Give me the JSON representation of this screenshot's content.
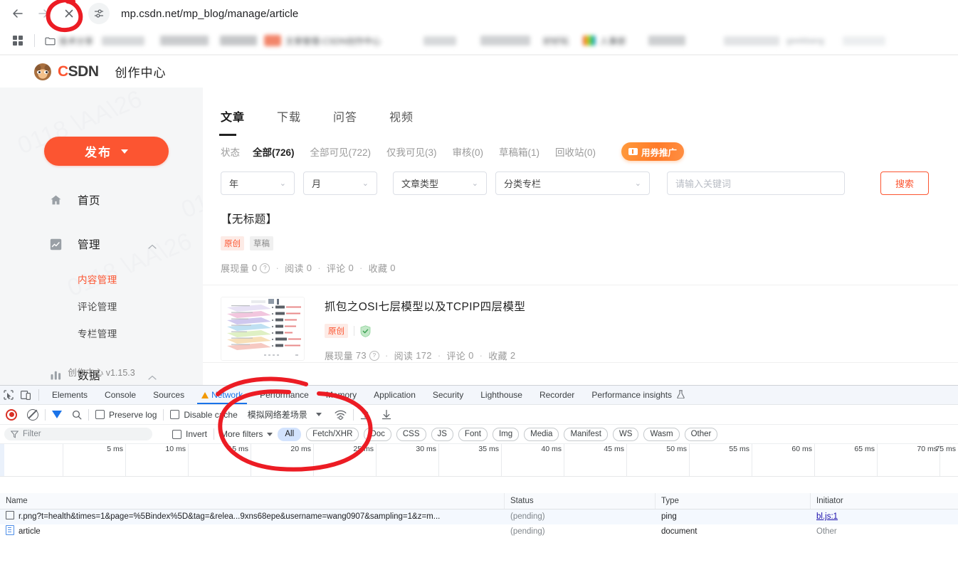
{
  "browser": {
    "url": "mp.csdn.net/mp_blog/manage/article",
    "back_icon": "back-arrow-icon",
    "forward_icon": "forward-arrow-icon",
    "stop_icon": "stop-loading-icon",
    "site_info_icon": "site-settings-icon",
    "apps_icon": "apps-grid-icon",
    "bookmarks": [
      {
        "label": "技术分享",
        "icon": "folder-icon",
        "blurred": true
      },
      {
        "label": "",
        "icon": "",
        "blurred": true
      },
      {
        "label": "",
        "icon": "",
        "blurred": true
      },
      {
        "label": "文章管理-CSDN创作中心",
        "icon": "csdn-icon",
        "blurred": true
      },
      {
        "label": "",
        "icon": "",
        "blurred": true
      },
      {
        "label": "好好玩",
        "icon": "",
        "blurred": true
      },
      {
        "label": "人事部",
        "icon": "rainbow-icon",
        "blurred": true
      },
      {
        "label": "",
        "icon": "",
        "blurred": true
      },
      {
        "label": "geekbang",
        "icon": "",
        "blurred": true
      }
    ]
  },
  "csdn": {
    "brand": "CSDN",
    "brand_prefix": "C",
    "brand_rest": "SDN",
    "subtitle": "创作中心",
    "logo_icon": "csdn-monkey-logo",
    "version": "创作中心 v1.15.3",
    "publish_button": "发布",
    "publish_caret_icon": "chevron-down-icon",
    "sidebar": [
      {
        "label": "首页",
        "icon": "home-icon",
        "expandable": false
      },
      {
        "label": "管理",
        "icon": "chart-line-icon",
        "expandable": true,
        "chevron": "chevron-up-icon",
        "children": [
          {
            "label": "内容管理",
            "active": true
          },
          {
            "label": "评论管理",
            "active": false
          },
          {
            "label": "专栏管理",
            "active": false
          }
        ]
      },
      {
        "label": "数据",
        "icon": "bar-chart-icon",
        "expandable": true,
        "chevron": "chevron-up-icon",
        "children": []
      }
    ],
    "watermark_text": "0118 \\AA\\26",
    "tabs": [
      {
        "label": "文章",
        "active": true
      },
      {
        "label": "下载",
        "active": false
      },
      {
        "label": "问答",
        "active": false
      },
      {
        "label": "视频",
        "active": false
      }
    ],
    "status_label": "状态",
    "status_items": [
      {
        "label": "全部(726)",
        "active": true
      },
      {
        "label": "全部可见(722)",
        "active": false
      },
      {
        "label": "仅我可见(3)",
        "active": false
      },
      {
        "label": "审核(0)",
        "active": false
      },
      {
        "label": "草稿箱(1)",
        "active": false
      },
      {
        "label": "回收站(0)",
        "active": false
      }
    ],
    "promo_badge": "用券推广",
    "promo_icon": "coupon-ticket-icon",
    "filters": {
      "year": "年",
      "month": "月",
      "article_type": "文章类型",
      "category": "分类专栏",
      "keyword_placeholder": "请输入关键词",
      "keyword_value": "",
      "search_button": "搜索",
      "chevron_icon": "chevron-down-icon"
    },
    "articles": [
      {
        "title": "【无标题】",
        "has_thumb": false,
        "badges": [
          "原创",
          "草稿"
        ],
        "badge_types": [
          "original",
          "draft"
        ],
        "verified": false,
        "stats": {
          "impressions_label": "展现量",
          "impressions": "0",
          "read_label": "阅读",
          "read": "0",
          "comment_label": "评论",
          "comment": "0",
          "collect_label": "收藏",
          "collect": "0"
        }
      },
      {
        "title": "抓包之OSI七层模型以及TCPIP四层模型",
        "has_thumb": true,
        "thumb_icon": "osi-layers-thumbnail",
        "badges": [
          "原创"
        ],
        "badge_types": [
          "original"
        ],
        "verified": true,
        "verified_icon": "shield-check-icon",
        "stats": {
          "impressions_label": "展现量",
          "impressions": "73",
          "read_label": "阅读",
          "read": "172",
          "comment_label": "评论",
          "comment": "0",
          "collect_label": "收藏",
          "collect": "2"
        }
      }
    ]
  },
  "devtools": {
    "inspect_icon": "inspect-element-icon",
    "device_icon": "device-toolbar-icon",
    "tabs": [
      {
        "label": "Elements",
        "active": false,
        "warn": false
      },
      {
        "label": "Console",
        "active": false,
        "warn": false
      },
      {
        "label": "Sources",
        "active": false,
        "warn": false
      },
      {
        "label": "Network",
        "active": true,
        "warn": true
      },
      {
        "label": "Performance",
        "active": false,
        "warn": false
      },
      {
        "label": "Memory",
        "active": false,
        "warn": false
      },
      {
        "label": "Application",
        "active": false,
        "warn": false
      },
      {
        "label": "Security",
        "active": false,
        "warn": false
      },
      {
        "label": "Lighthouse",
        "active": false,
        "warn": false
      },
      {
        "label": "Recorder",
        "active": false,
        "warn": false
      },
      {
        "label": "Performance insights",
        "active": false,
        "warn": false,
        "flask": true
      }
    ],
    "toolbar": {
      "record_icon": "record-stop-icon",
      "clear_icon": "clear-network-log-icon",
      "filter_icon": "filter-funnel-icon",
      "search_icon": "search-icon",
      "preserve_log": "Preserve log",
      "disable_cache": "Disable cache",
      "throttling": "模拟网络差场景",
      "throttle_caret_icon": "chevron-down-icon",
      "wifi_icon": "network-conditions-icon",
      "import_icon": "import-har-icon",
      "export_icon": "export-har-icon"
    },
    "filterbar": {
      "filter_placeholder": "Filter",
      "filter_icon": "filter-icon",
      "invert": "Invert",
      "more_filters": "More filters",
      "more_filters_caret_icon": "chevron-down-icon",
      "chips": [
        "All",
        "Fetch/XHR",
        "Doc",
        "CSS",
        "JS",
        "Font",
        "Img",
        "Media",
        "Manifest",
        "WS",
        "Wasm",
        "Other"
      ],
      "active_chip": "All"
    },
    "ruler_ticks": [
      "5 ms",
      "10 ms",
      "15 ms",
      "20 ms",
      "25 ms",
      "30 ms",
      "35 ms",
      "40 ms",
      "45 ms",
      "50 ms",
      "55 ms",
      "60 ms",
      "65 ms",
      "70 ms",
      "75 ms"
    ],
    "table": {
      "columns": [
        "Name",
        "Status",
        "Type",
        "Initiator"
      ],
      "rows": [
        {
          "name": "r.png?t=health&times=1&page=%5Bindex%5D&tag=&relea...9xns68epe&username=wang0907&sampling=1&z=m...",
          "name_icon": "ping-request-icon",
          "status": "(pending)",
          "type": "ping",
          "initiator": "bl.js:1",
          "initiator_link": true
        },
        {
          "name": "article",
          "name_icon": "document-request-icon",
          "status": "(pending)",
          "type": "document",
          "initiator": "Other",
          "initiator_link": false
        }
      ]
    }
  },
  "annotations": {
    "color": "#ec1c24",
    "marks": [
      {
        "name": "circle-around-stop-button",
        "shape": "circle"
      },
      {
        "name": "circle-around-network-throttling",
        "shape": "circle"
      },
      {
        "name": "arc-under-article-thumbnail",
        "shape": "arc"
      }
    ]
  }
}
